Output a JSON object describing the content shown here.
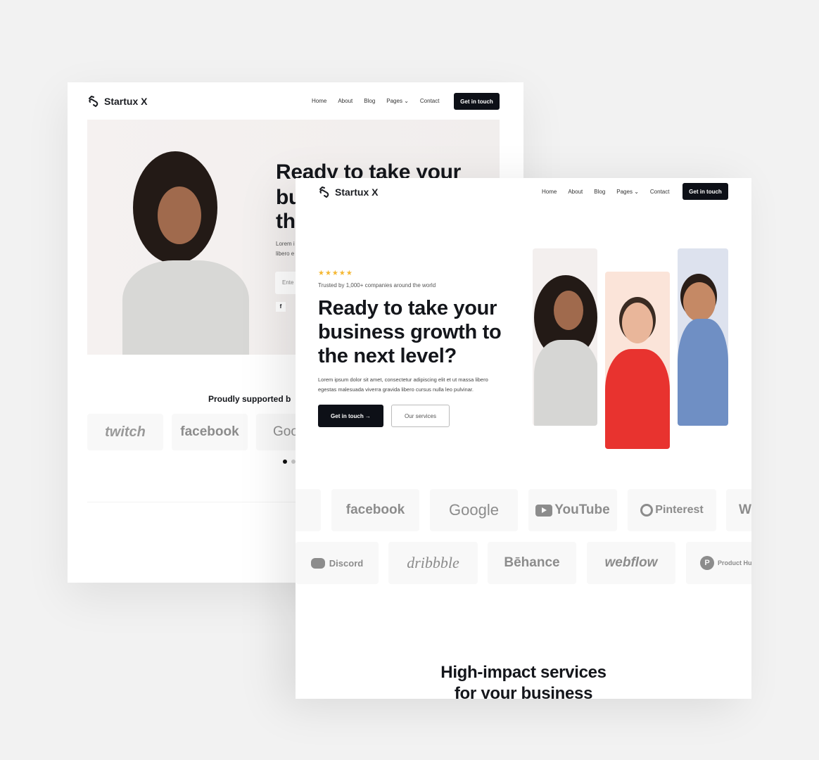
{
  "brand": "Startux X",
  "nav": {
    "items": [
      "Home",
      "About",
      "Blog",
      "Pages",
      "Contact"
    ],
    "cta": "Get in touch"
  },
  "back": {
    "headline": "Ready to take your",
    "headline_partial": [
      "bu",
      "th"
    ],
    "para_partial": [
      "Lorem i",
      "libero e"
    ],
    "input_partial": "Ente",
    "social_partial": "f",
    "supported": "Proudly supported b",
    "logos": [
      "twitch",
      "facebook",
      "Goo"
    ]
  },
  "front": {
    "rating_stars": 5,
    "star_color": "#f5b731",
    "trusted": "Trusted by 1,000+ companies around the world",
    "headline": [
      "Ready to take your",
      "business growth to",
      "the next level?"
    ],
    "paragraph": [
      "Lorem ipsum dolor sit amet, consectetur adipiscing elit et ut massa libero",
      "egestas malesuada viverra gravida libero cursus nulla leo pulvinar."
    ],
    "primary_button": "Get in touch →",
    "secondary_button": "Our services",
    "logos_row1": [
      "facebook",
      "Google",
      "YouTube",
      "Pinterest",
      "W"
    ],
    "logos_row2": [
      "Discord",
      "dribbble",
      "Bēhance",
      "webflow",
      "Product Hu"
    ],
    "services_heading": [
      "High-impact services",
      "for your business"
    ]
  }
}
